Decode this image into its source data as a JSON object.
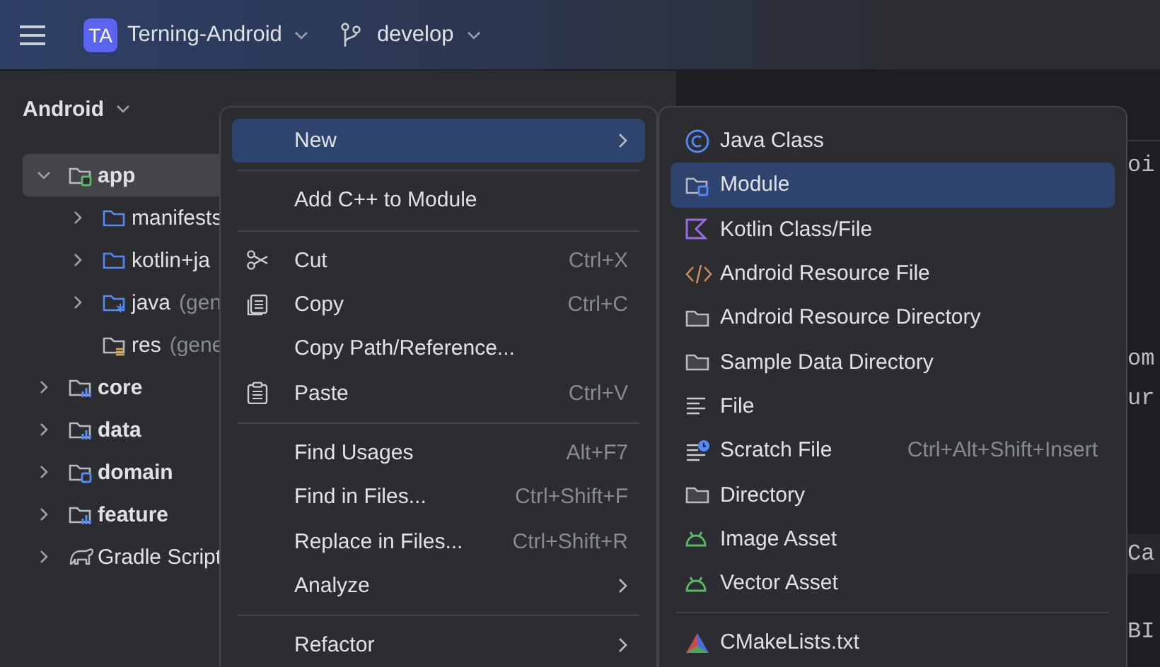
{
  "title_bar": {
    "project_badge": "TA",
    "project": "Terning-Android",
    "branch": "develop"
  },
  "sidebar": {
    "view": "Android",
    "tree": [
      {
        "label": "app",
        "kind": "app",
        "expanded": true,
        "selected": true,
        "children": [
          {
            "label": "manifests",
            "kind": "folder",
            "expanded": false,
            "selected": false
          },
          {
            "label": "kotlin+ja",
            "kind": "folder",
            "expanded": false,
            "selected": false
          },
          {
            "label": "java",
            "note": "(gen",
            "kind": "generated",
            "expanded": false,
            "selected": false
          },
          {
            "label": "res",
            "note": "(gene",
            "kind": "resources",
            "selected": false
          }
        ]
      },
      {
        "label": "core",
        "kind": "module",
        "expanded": false,
        "selected": false
      },
      {
        "label": "data",
        "kind": "module",
        "expanded": false,
        "selected": false
      },
      {
        "label": "domain",
        "kind": "library",
        "expanded": false,
        "selected": false
      },
      {
        "label": "feature",
        "kind": "module",
        "expanded": false,
        "selected": false
      },
      {
        "label": "Gradle Script",
        "kind": "gradle",
        "expanded": false,
        "selected": false
      }
    ]
  },
  "editor": {
    "lines": [
      {
        "text": "oi",
        "highlighted": false
      },
      {
        "text": "om",
        "highlighted": false
      },
      {
        "text": "ur",
        "highlighted": false
      },
      {
        "text": "Ca",
        "highlighted": true
      },
      {
        "text": "BI",
        "highlighted": false
      }
    ]
  },
  "context_menu": {
    "items": [
      {
        "kind": "plain",
        "label": "New",
        "submenu": true,
        "selected": true
      },
      {
        "kind": "separator"
      },
      {
        "kind": "plain",
        "label": "Add C++ to Module",
        "submenu": false,
        "selected": false
      },
      {
        "kind": "separator"
      },
      {
        "kind": "cut",
        "label": "Cut",
        "shortcut": "Ctrl+X",
        "submenu": false,
        "selected": false
      },
      {
        "kind": "copy",
        "label": "Copy",
        "shortcut": "Ctrl+C",
        "submenu": false,
        "selected": false
      },
      {
        "kind": "plain",
        "label": "Copy Path/Reference...",
        "submenu": false,
        "selected": false
      },
      {
        "kind": "paste",
        "label": "Paste",
        "shortcut": "Ctrl+V",
        "submenu": false,
        "selected": false
      },
      {
        "kind": "separator"
      },
      {
        "kind": "plain",
        "label": "Find Usages",
        "shortcut": "Alt+F7",
        "submenu": false,
        "selected": false
      },
      {
        "kind": "plain",
        "label": "Find in Files...",
        "shortcut": "Ctrl+Shift+F",
        "submenu": false,
        "selected": false
      },
      {
        "kind": "plain",
        "label": "Replace in Files...",
        "shortcut": "Ctrl+Shift+R",
        "submenu": false,
        "selected": false
      },
      {
        "kind": "plain",
        "label": "Analyze",
        "submenu": true,
        "selected": false
      },
      {
        "kind": "separator"
      },
      {
        "kind": "plain",
        "label": "Refactor",
        "submenu": true,
        "selected": false
      }
    ]
  },
  "new_submenu": {
    "items": [
      {
        "kind": "class",
        "label": "Java Class",
        "selected": false
      },
      {
        "kind": "module",
        "label": "Module",
        "selected": true
      },
      {
        "kind": "kotlin",
        "label": "Kotlin Class/File",
        "selected": false
      },
      {
        "kind": "xml",
        "label": "Android Resource File",
        "selected": false
      },
      {
        "kind": "folder",
        "label": "Android Resource Directory",
        "selected": false
      },
      {
        "kind": "folder",
        "label": "Sample Data Directory",
        "selected": false
      },
      {
        "kind": "text",
        "label": "File",
        "selected": false
      },
      {
        "kind": "scratch",
        "label": "Scratch File",
        "shortcut": "Ctrl+Alt+Shift+Insert",
        "selected": false
      },
      {
        "kind": "folder",
        "label": "Directory",
        "selected": false
      },
      {
        "kind": "android",
        "label": "Image Asset",
        "selected": false
      },
      {
        "kind": "android",
        "label": "Vector Asset",
        "selected": false
      },
      {
        "kind": "separator"
      },
      {
        "kind": "cmake",
        "label": "CMakeLists.txt",
        "selected": false
      }
    ]
  }
}
